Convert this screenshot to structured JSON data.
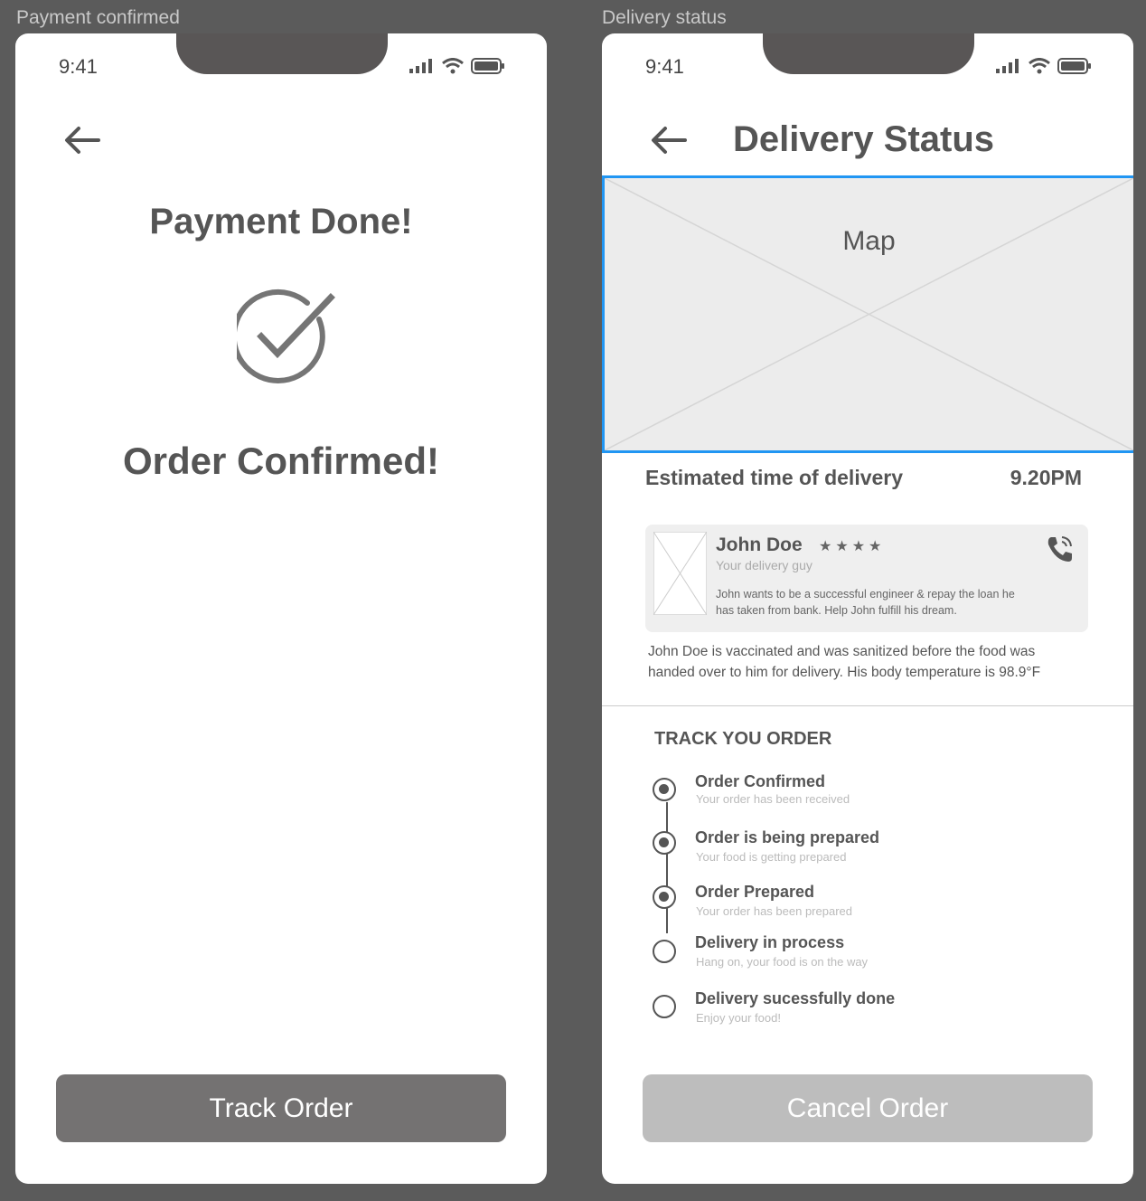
{
  "screens": {
    "payment": {
      "frame_label": "Payment confirmed",
      "time": "9:41",
      "title": "Payment Done!",
      "subtitle": "Order Confirmed!",
      "button_label": "Track Order"
    },
    "delivery": {
      "frame_label": "Delivery status",
      "time": "9:41",
      "title": "Delivery Status",
      "map_label": "Map",
      "eta_label": "Estimated time of delivery",
      "eta_value": "9.20PM",
      "courier": {
        "name": "John Doe",
        "rating": "★★★★",
        "role": "Your delivery guy",
        "bio_line1": "John wants to be a successful engineer & repay the loan he",
        "bio_line2": "has taken from bank. Help John fulfill his dream."
      },
      "safety_line1": "John Doe is vaccinated and was sanitized before the food was",
      "safety_line2": "handed over to him for delivery. His body temperature is 98.9°F",
      "track_heading": "TRACK YOU ORDER",
      "steps": [
        {
          "title": "Order Confirmed",
          "sub": "Your order has been received",
          "done": true
        },
        {
          "title": "Order is being prepared",
          "sub": "Your food is getting prepared",
          "done": true
        },
        {
          "title": "Order Prepared",
          "sub": "Your order has been prepared",
          "done": true
        },
        {
          "title": "Delivery in process",
          "sub": "Hang on, your food is on the way",
          "done": false
        },
        {
          "title": "Delivery sucessfully done",
          "sub": "Enjoy your food!",
          "done": false
        }
      ],
      "button_label": "Cancel Order"
    }
  },
  "colors": {
    "canvas": "#5b5b5b",
    "primary_button": "#747272",
    "disabled_button": "#bdbdbd",
    "map_border": "#2196f3",
    "text": "#555555"
  }
}
